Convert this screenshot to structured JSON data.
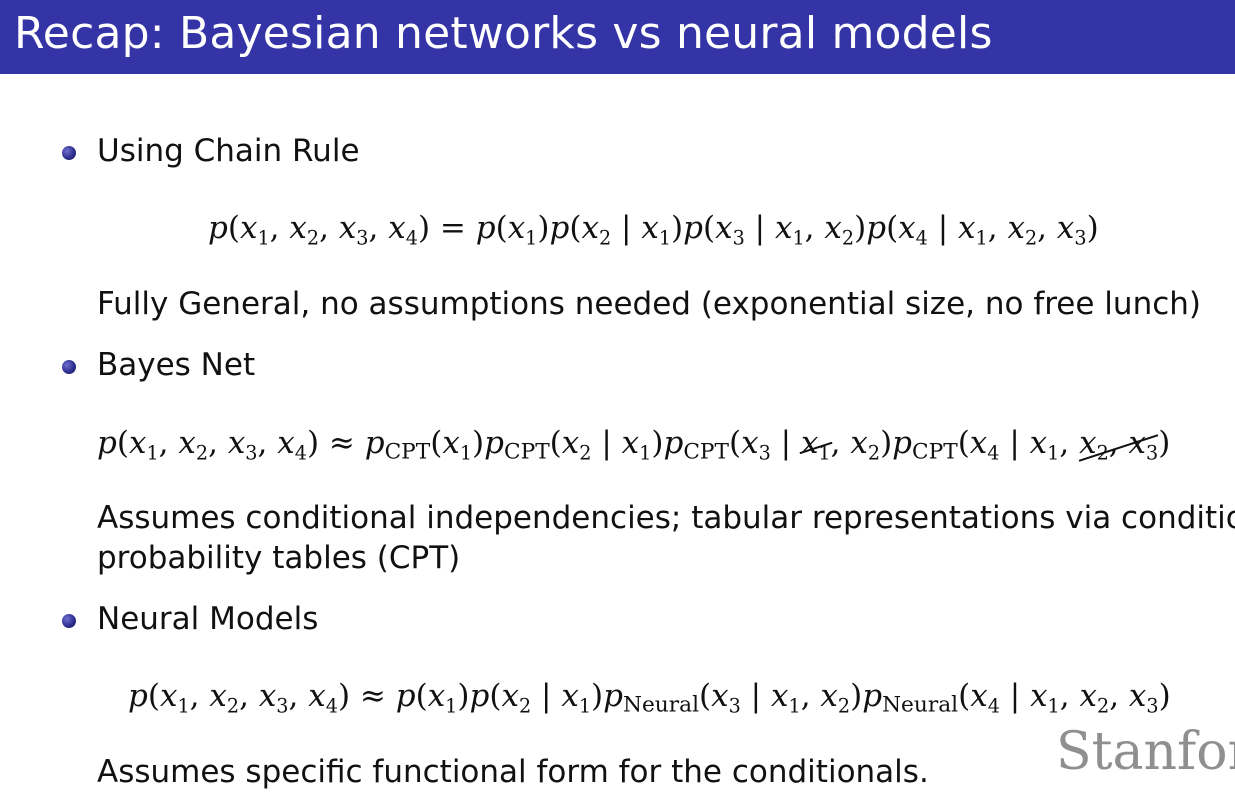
{
  "slide": {
    "title": "Recap: Bayesian networks vs neural models",
    "watermark": "Stanfor"
  },
  "sections": [
    {
      "bullet": "Using Chain Rule",
      "equation": "p(x1, x2, x3, x4) = p(x1)p(x2 | x1)p(x3 | x1, x2)p(x4 | x1, x2, x3)",
      "description": "Fully General, no assumptions needed (exponential size, no free lunch)"
    },
    {
      "bullet": "Bayes Net",
      "equation": "p(x1, x2, x3, x4) ≈ pCPT(x1)pCPT(x2 | x1)pCPT(x3 | x1, x2)pCPT(x4 | x1, x2, x3)",
      "crossed_out_terms": [
        "x1",
        "x2, x3"
      ],
      "description_line1": "Assumes conditional independencies; tabular representations via conditional",
      "description_line2": "probability tables (CPT)"
    },
    {
      "bullet": "Neural Models",
      "equation": "p(x1, x2, x3, x4) ≈ p(x1)p(x2 | x1)pNeural(x3 | x1, x2)pNeural(x4 | x1, x2, x3)",
      "description": "Assumes specific functional form for the conditionals."
    }
  ]
}
